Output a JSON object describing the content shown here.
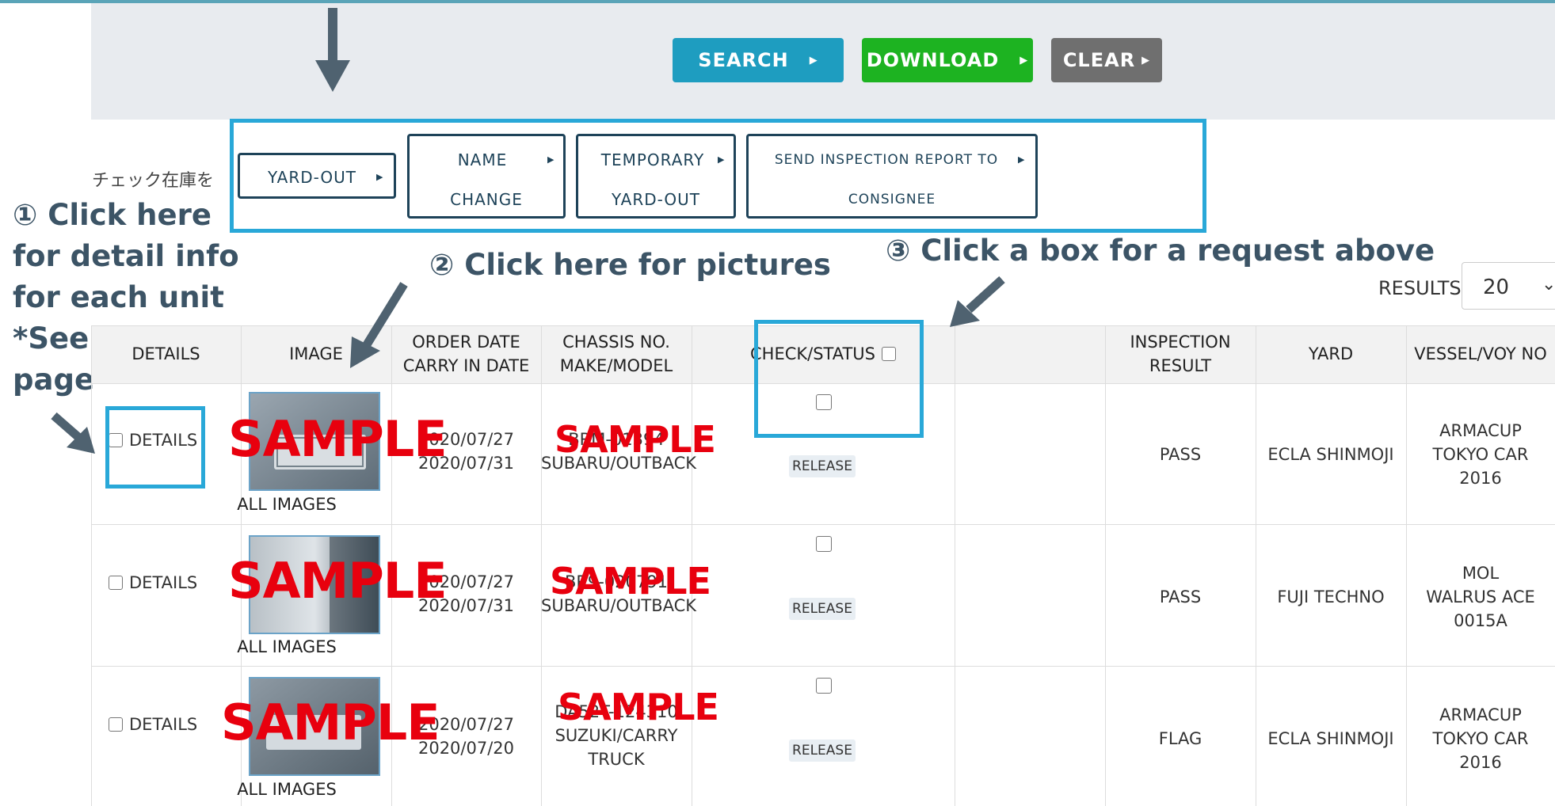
{
  "toolbar": {
    "search_label": "SEARCH",
    "download_label": "DOWNLOAD",
    "clear_label": "CLEAR"
  },
  "request": {
    "label": "チェック在庫を",
    "yard_out": "YARD-OUT",
    "name_change_1": "NAME",
    "name_change_2": "CHANGE",
    "temp_1": "TEMPORARY",
    "temp_2": "YARD-OUT",
    "send_1": "SEND INSPECTION REPORT TO",
    "send_2": "CONSIGNEE"
  },
  "annotations": {
    "a1_l1": "① Click here",
    "a1_l2": "for detail info",
    "a1_l3": "for each unit",
    "a1_l4": "*See next",
    "a1_l5": "page",
    "a2": "② Click here for pictures",
    "a3": "③ Click a box for a request above"
  },
  "results": {
    "label": "RESULTS",
    "value": "20"
  },
  "table": {
    "headers": {
      "details": "DETAILS",
      "image": "IMAGE",
      "order_1": "ORDER DATE",
      "order_2": "CARRY IN DATE",
      "chassis_1": "CHASSIS NO.",
      "chassis_2": "MAKE/MODEL",
      "check": "CHECK/STATUS",
      "inspection_1": "INSPECTION",
      "inspection_2": "RESULT",
      "yard": "YARD",
      "vessel": "VESSEL/VOY NO"
    },
    "rows": [
      {
        "details": "DETAILS",
        "all_images": "ALL IMAGES",
        "order_date": "2020/07/27",
        "carry_in_date": "2020/07/31",
        "chassis": "BRM-01394",
        "make_model": "SUBARU/OUTBACK",
        "make_model_2": "",
        "status": "RELEASE",
        "result": "PASS",
        "yard": "ECLA SHINMOJI",
        "vessel_1": "ARMACUP",
        "vessel_2": "TOKYO CAR",
        "vessel_3": "2016"
      },
      {
        "details": "DETAILS",
        "all_images": "ALL IMAGES",
        "order_date": "2020/07/27",
        "carry_in_date": "2020/07/31",
        "chassis": "BR9-020791",
        "make_model": "SUBARU/OUTBACK",
        "make_model_2": "",
        "status": "RELEASE",
        "result": "PASS",
        "yard": "FUJI TECHNO",
        "vessel_1": "MOL",
        "vessel_2": "WALRUS ACE",
        "vessel_3": "0015A"
      },
      {
        "details": "DETAILS",
        "all_images": "ALL IMAGES",
        "order_date": "2020/07/27",
        "carry_in_date": "2020/07/20",
        "chassis": "DA52T-124310",
        "make_model": "SUZUKI/CARRY",
        "make_model_2": "TRUCK",
        "status": "RELEASE",
        "result": "FLAG",
        "yard": "ECLA SHINMOJI",
        "vessel_1": "ARMACUP",
        "vessel_2": "TOKYO CAR",
        "vessel_3": "2016"
      }
    ]
  },
  "watermark": "SAMPLE",
  "colors": {
    "accent_blue": "#1e9dc0",
    "download_green": "#1db321",
    "clear_gray": "#6f6f6f",
    "highlight_blue": "#29a8d8",
    "annotation_text": "#3c5466",
    "sample_red": "#e8000e"
  }
}
